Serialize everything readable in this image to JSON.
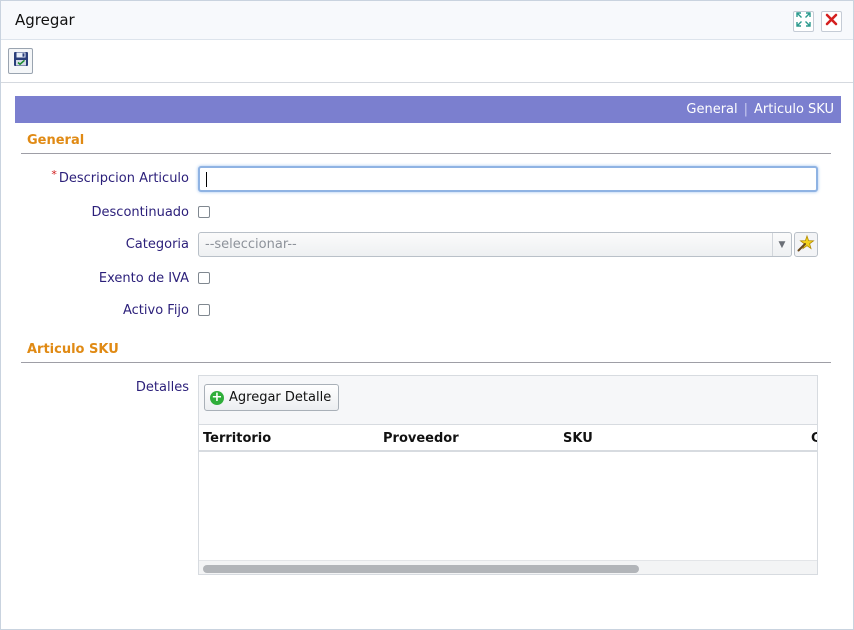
{
  "window": {
    "title": "Agregar",
    "maximize_icon": "maximize-icon",
    "close_icon": "close-icon"
  },
  "toolbar": {
    "save_icon": "save-icon"
  },
  "tabs": {
    "items": [
      "General",
      "Articulo SKU"
    ],
    "separator": "|"
  },
  "general": {
    "title": "General",
    "descripcion_label": "Descripcion Articulo",
    "descripcion_required": "*",
    "descripcion_value": "",
    "descontinuado_label": "Descontinuado",
    "descontinuado_checked": false,
    "categoria_label": "Categoria",
    "categoria_value": "--seleccionar--",
    "exento_label": "Exento de IVA",
    "exento_checked": false,
    "activo_label": "Activo Fijo",
    "activo_checked": false
  },
  "sku": {
    "title": "Articulo SKU",
    "detalles_label": "Detalles",
    "add_button": "Agregar Detalle",
    "columns": [
      "Territorio",
      "Proveedor",
      "SKU",
      "C"
    ],
    "rows": []
  },
  "colors": {
    "tabs_bar": "#7b7fcf",
    "section_title": "#e08a14",
    "label": "#2b1f7a",
    "required": "#d01b1b"
  }
}
